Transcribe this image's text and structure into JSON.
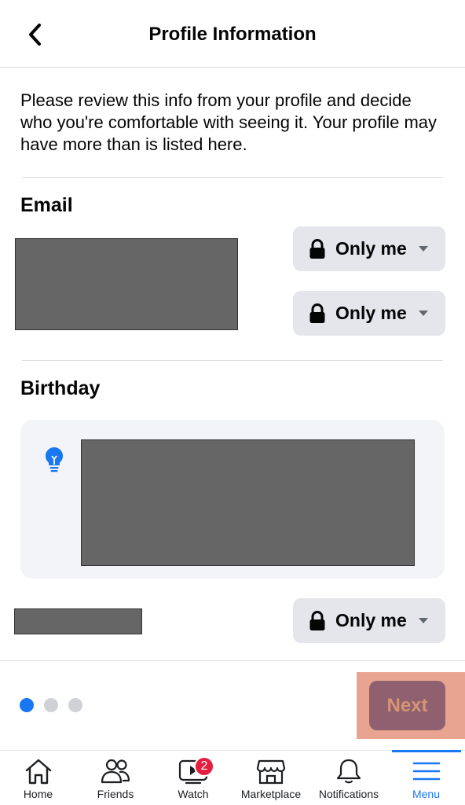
{
  "header": {
    "title": "Profile Information"
  },
  "intro_text": "Please review this info from your profile and decide who you're comfortable with seeing it. Your profile may have more than is listed here.",
  "sections": {
    "email": {
      "title": "Email",
      "audience": [
        "Only me",
        "Only me"
      ]
    },
    "birthday": {
      "title": "Birthday",
      "audience": [
        "Only me"
      ]
    }
  },
  "pagination": {
    "total": 3,
    "current": 1
  },
  "next_button": {
    "label": "Next"
  },
  "tabbar": {
    "tabs": [
      {
        "label": "Home",
        "icon": "home-icon"
      },
      {
        "label": "Friends",
        "icon": "friends-icon"
      },
      {
        "label": "Watch",
        "icon": "watch-icon",
        "badge": "2"
      },
      {
        "label": "Marketplace",
        "icon": "marketplace-icon"
      },
      {
        "label": "Notifications",
        "icon": "bell-icon"
      },
      {
        "label": "Menu",
        "icon": "menu-icon",
        "active": true
      }
    ]
  },
  "colors": {
    "accent": "#1877f2",
    "badge": "#e41e3f",
    "button_bg": "#e4e6eb"
  }
}
